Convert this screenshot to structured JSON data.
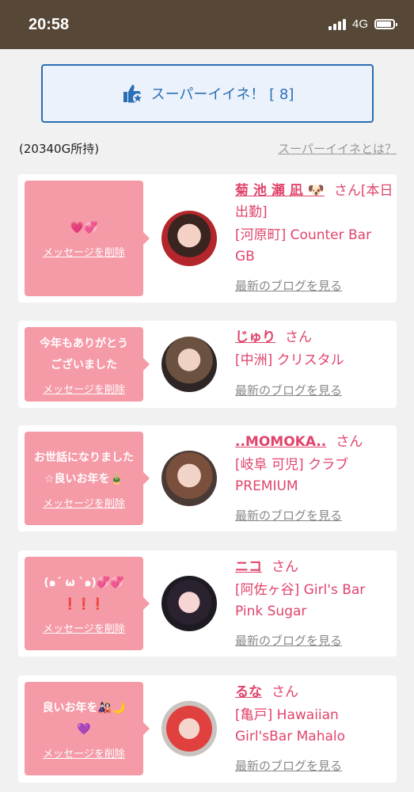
{
  "status": {
    "time": "20:58",
    "network": "4G"
  },
  "super_like": {
    "label": "スーパーイイネ！ [ 8]",
    "icon": "thumbs-up-star-icon"
  },
  "owned_label": "(20340G所持)",
  "what_is_label": "スーパーイイネとは？",
  "delete_label": "メッセージを削除",
  "blog_label": "最新のブログを見る",
  "san_label": "さん",
  "colors": {
    "statusbar": "#564737",
    "accent_blue": "#2a6eb5",
    "pink": "#f59aa7",
    "name_pink": "#e0446b"
  },
  "cards": [
    {
      "message": "💗💞",
      "name": "菊 池 瀬 凪 🐶",
      "suffix": "さん[本日出勤]",
      "shop": "[河原町] Counter Bar GB"
    },
    {
      "message": "今年もありがとう\nございました",
      "name": "じゅり",
      "suffix": "さん",
      "shop": "[中洲] クリスタル"
    },
    {
      "message": "お世話になりました\n☆良いお年を🎍",
      "name": "..MOMOKA..",
      "suffix": "さん",
      "shop": "[岐阜 可児] クラブPREMIUM"
    },
    {
      "message": "(๑ˊ ω ˋ๑)💞💞\n❗❗❗",
      "name": "ニコ",
      "suffix": "さん",
      "shop": "[阿佐ヶ谷] Girl's Bar Pink Sugar"
    },
    {
      "message": "良いお年を🎎🌙\n💜",
      "name": "るな",
      "suffix": "さん",
      "shop": "[亀戸] Hawaiian Girl'sBar Mahalo"
    }
  ]
}
